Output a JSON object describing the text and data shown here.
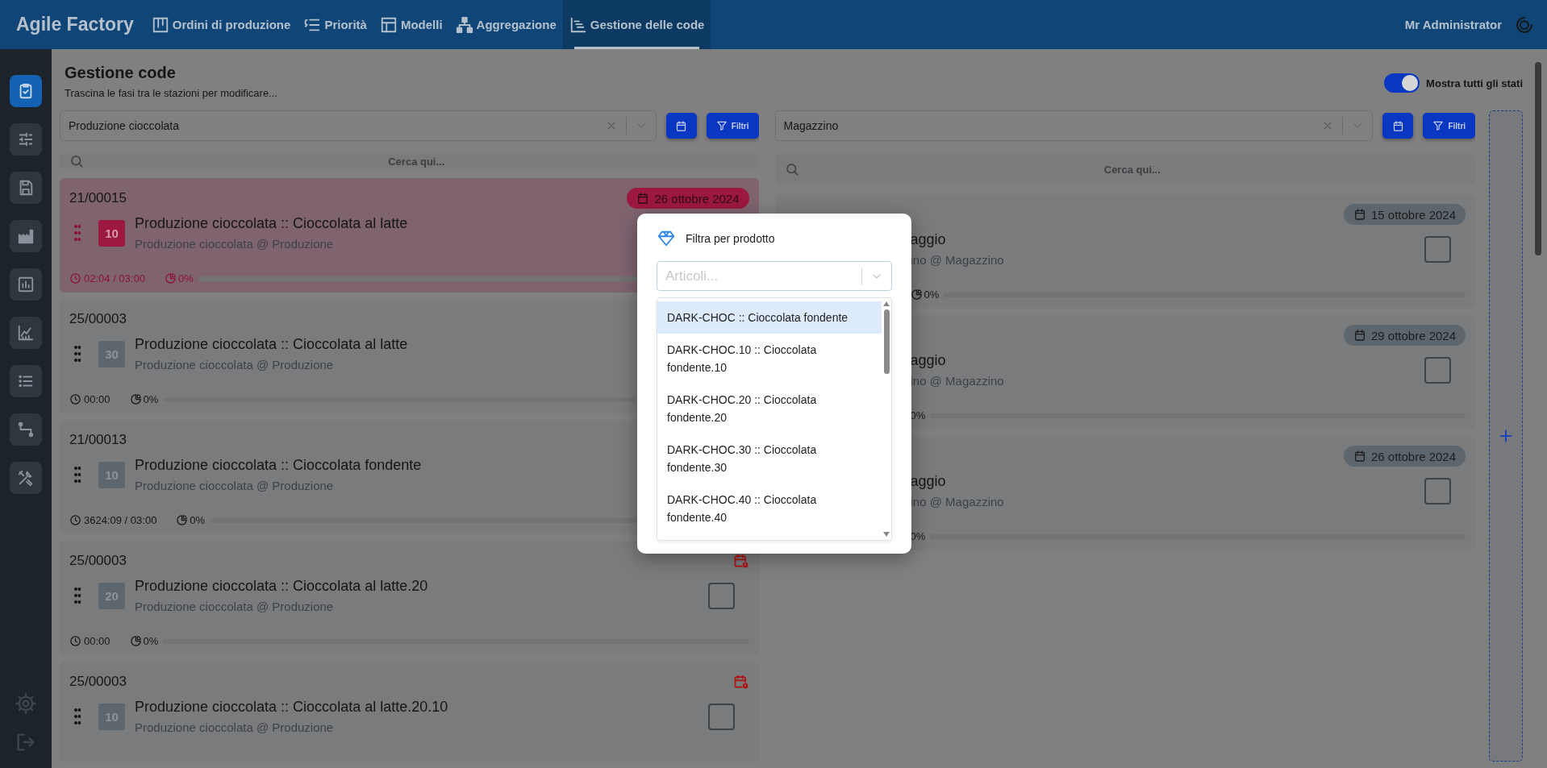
{
  "header": {
    "brand": "Agile Factory",
    "user": "Mr Administrator",
    "nav": [
      {
        "label": "Ordini di produzione",
        "selected": false
      },
      {
        "label": "Priorità",
        "selected": false
      },
      {
        "label": "Modelli",
        "selected": false
      },
      {
        "label": "Aggregazione",
        "selected": false
      },
      {
        "label": "Gestione delle code",
        "selected": true
      }
    ]
  },
  "sidebar": {
    "items": [
      {
        "selected": true
      },
      {
        "selected": false
      },
      {
        "selected": false
      },
      {
        "selected": false
      },
      {
        "selected": false
      },
      {
        "selected": false
      },
      {
        "selected": false
      },
      {
        "selected": false
      },
      {
        "selected": false
      }
    ]
  },
  "page": {
    "title": "Gestione code",
    "subtitle": "Trascina le fasi tra le stazioni per modificare...",
    "show_all_states": {
      "label": "Mostra tutti gli stati",
      "on": true
    }
  },
  "columns": [
    {
      "station": "Produzione cioccolata",
      "search_placeholder": "Cerca qui...",
      "filter_button": "Filtri",
      "covered": false,
      "cards": [
        {
          "code": "21/00015",
          "late": true,
          "date": "26 ottobre 2024",
          "badge": "10",
          "title": "Produzione cioccolata :: Cioccolata al latte",
          "subtitle": "Produzione cioccolata @ Produzione",
          "time": "02:04 / 03:00",
          "progress_icon": true,
          "progress": "0%",
          "level": 0
        },
        {
          "code": "25/00003",
          "late": false,
          "badge": "30",
          "title": "Produzione cioccolata :: Cioccolata al latte",
          "subtitle": "Produzione cioccolata @ Produzione",
          "time": "00:00",
          "progress_icon": true,
          "progress": "0%",
          "level": 0
        },
        {
          "code": "21/00013",
          "late": false,
          "badge": "10",
          "title": "Produzione cioccolata :: Cioccolata fondente",
          "subtitle": "Produzione cioccolata @ Produzione",
          "time": "3624:09 / 03:00",
          "progress_icon": true,
          "progress": "0%",
          "level": 0
        },
        {
          "code": "25/00003",
          "late": false,
          "date_alert": true,
          "badge": "20",
          "title": "Produzione cioccolata :: Cioccolata al latte.20",
          "subtitle": "Produzione cioccolata @ Produzione",
          "checked": false,
          "time": "00:00",
          "progress_icon": true,
          "progress": "0%",
          "level": 0
        },
        {
          "code": "25/00003",
          "late": false,
          "date_alert": true,
          "badge": "10",
          "title": "Produzione cioccolata :: Cioccolata al latte.20.10",
          "subtitle": "Produzione cioccolata @ Produzione",
          "checked": false
        }
      ]
    },
    {
      "station": "Magazzino",
      "search_placeholder": "Cerca qui...",
      "filter_button": "Filtri",
      "covered": true,
      "cards": [
        {
          "late": false,
          "date": "15 ottobre 2024",
          "title": "aggio",
          "subtitle": "ino @ Magazzino",
          "checked": false,
          "progress_icon": true,
          "progress": "0%",
          "level": 0
        },
        {
          "late": false,
          "date": "29 ottobre 2024",
          "title": "aggio",
          "subtitle": "ino @ Magazzino",
          "checked": false,
          "progress_icon": false,
          "progress": "0%",
          "level": 0
        },
        {
          "late": false,
          "date": "26 ottobre 2024",
          "title": "aggio",
          "subtitle": "ino @ Magazzino",
          "checked": false,
          "progress_icon": false,
          "progress": "0%",
          "level": 0
        }
      ]
    }
  ],
  "modal": {
    "title": "Filtra per prodotto",
    "placeholder": "Articoli...",
    "options": [
      {
        "label": "DARK-CHOC :: Cioccolata fondente",
        "selected": true
      },
      {
        "label": "DARK-CHOC.10 :: Cioccolata fondente.10",
        "selected": false
      },
      {
        "label": "DARK-CHOC.20 :: Cioccolata fondente.20",
        "selected": false
      },
      {
        "label": "DARK-CHOC.30 :: Cioccolata fondente.30",
        "selected": false
      },
      {
        "label": "DARK-CHOC.40 :: Cioccolata fondente.40",
        "selected": false
      }
    ]
  }
}
